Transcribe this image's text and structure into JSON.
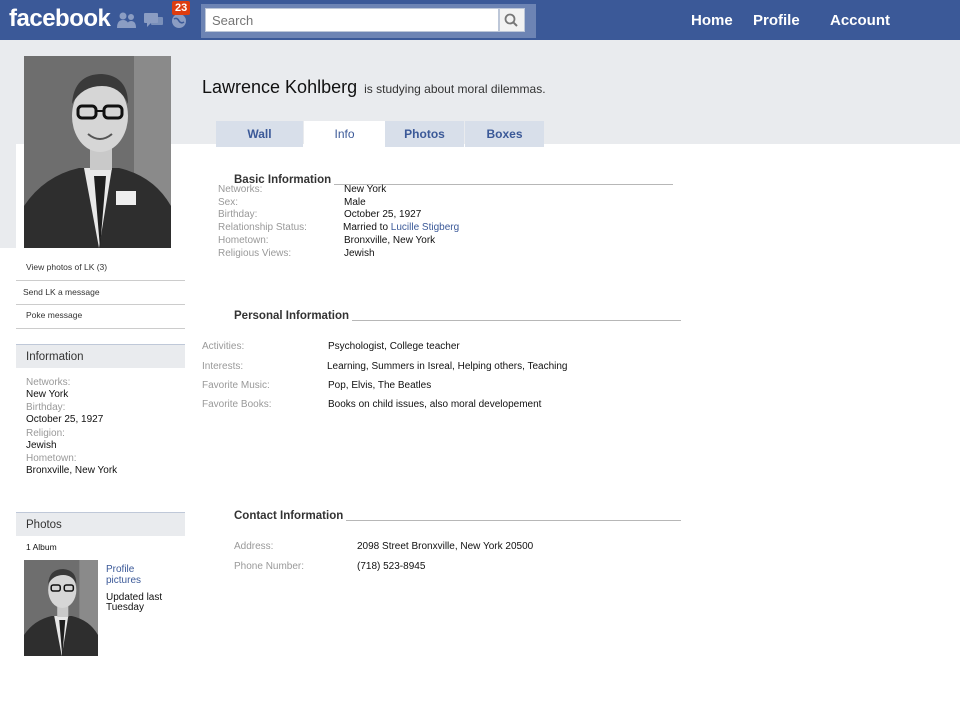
{
  "topbar": {
    "logo": "facebook",
    "notification_count": "23",
    "search_placeholder": "Search",
    "nav": [
      "Home",
      "Profile",
      "Account"
    ]
  },
  "profile": {
    "name": "Lawrence Kohlberg",
    "status": "is studying about moral dilemmas."
  },
  "tabs": [
    "Wall",
    "Info",
    "Photos",
    "Boxes"
  ],
  "sidebar": {
    "links": [
      "View photos of LK (3)",
      "Send  LK a message",
      "Poke message"
    ],
    "information": {
      "heading": "Information",
      "items": [
        {
          "label": "Networks:",
          "value": "New York"
        },
        {
          "label": "Birthday:",
          "value": "October 25, 1927"
        },
        {
          "label": "Religion:",
          "value": "Jewish"
        },
        {
          "label": "Hometown:",
          "value": "Bronxville, New York"
        }
      ]
    },
    "photos": {
      "heading": "Photos",
      "album_count": "1 Album",
      "album_title": "Profile pictures",
      "updated": "Updated last Tuesday"
    }
  },
  "basic_info": {
    "title": "Basic Information",
    "rows": [
      {
        "label": "Networks:",
        "value": "New York"
      },
      {
        "label": "Sex:",
        "value": "Male"
      },
      {
        "label": "Birthday:",
        "value": "October 25, 1927"
      },
      {
        "label": "Relationship Status:",
        "value": "Married to ",
        "link": "Lucille Stigberg"
      },
      {
        "label": "Hometown:",
        "value": "Bronxville, New York"
      },
      {
        "label": "Religious Views:",
        "value": "Jewish"
      }
    ]
  },
  "personal_info": {
    "title": "Personal Information",
    "rows": [
      {
        "label": "Activities:",
        "value": "Psychologist, College teacher"
      },
      {
        "label": "Interests:",
        "value": "Learning, Summers in Isreal, Helping others, Teaching"
      },
      {
        "label": "Favorite Music:",
        "value": "Pop, Elvis, The Beatles"
      },
      {
        "label": "Favorite Books:",
        "value": "Books on child issues, also moral developement"
      }
    ]
  },
  "contact_info": {
    "title": "Contact Information",
    "rows": [
      {
        "label": "Address:",
        "value": "2098 Street Bronxville, New York 20500"
      },
      {
        "label": "Phone Number:",
        "value": "(718) 523-8945"
      }
    ]
  },
  "colors": {
    "brand": "#3b5998",
    "badge": "#dd3c10",
    "band": "#e9ebee"
  }
}
